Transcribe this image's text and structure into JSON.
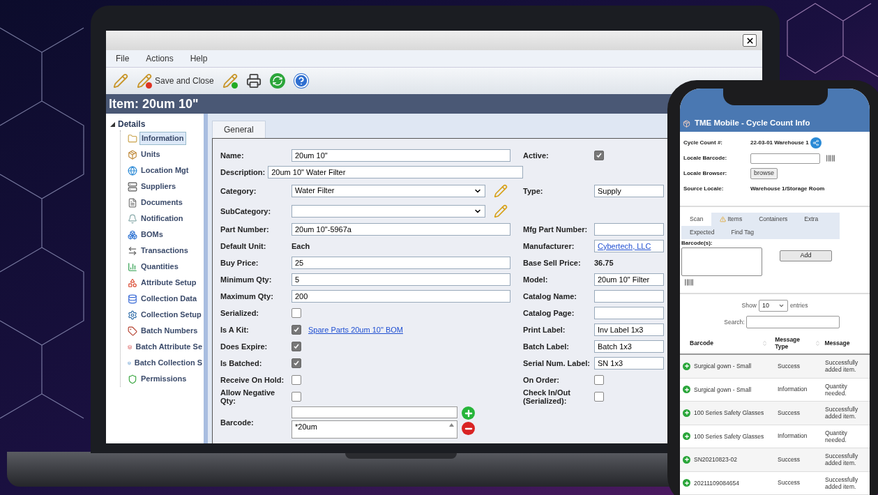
{
  "laptop": {
    "menu": [
      "File",
      "Actions",
      "Help"
    ],
    "toolbar": {
      "save_label": "Save and Close"
    },
    "header": "Item: 20um 10\"",
    "tree": {
      "label": "Details",
      "expanded": true,
      "children": [
        {
          "label": "Information",
          "selected": true
        },
        {
          "label": "Units",
          "selected": false
        },
        {
          "label": "Location Mgt",
          "selected": false
        },
        {
          "label": "Suppliers",
          "selected": false
        },
        {
          "label": "Documents",
          "selected": false
        },
        {
          "label": "Notification",
          "selected": false
        },
        {
          "label": "BOMs",
          "selected": false
        },
        {
          "label": "Transactions",
          "selected": false
        },
        {
          "label": "Quantities",
          "selected": false
        },
        {
          "label": "Attribute Setup",
          "selected": false
        },
        {
          "label": "Collection Data",
          "selected": false
        },
        {
          "label": "Collection Setup",
          "selected": false
        },
        {
          "label": "Batch Numbers",
          "selected": false
        },
        {
          "label": "Batch Attribute Se",
          "selected": false
        },
        {
          "label": "Batch Collection S",
          "selected": false
        },
        {
          "label": "Permissions",
          "selected": false
        }
      ]
    },
    "tabs": [
      {
        "label": "General",
        "selected": true
      }
    ],
    "rows": [
      {
        "left": {
          "label": "Name:",
          "kind": "input",
          "value": "20um 10\""
        },
        "right": {
          "label": "Active:",
          "kind": "checkbox",
          "checked": true
        }
      },
      {
        "left": {
          "label": "Description:",
          "kind": "wide",
          "value": "20um 10\" Water Filter"
        }
      },
      {
        "left": {
          "label": "Category:",
          "kind": "select",
          "value": "Water Filter"
        },
        "right": {
          "label": "Type:",
          "kind": "input",
          "value": "Supply"
        }
      },
      {
        "left": {
          "label": "SubCategory:",
          "kind": "select"
        }
      },
      {
        "left": {
          "label": "Part Number:",
          "kind": "input",
          "value": "20um 10\"-5967a"
        },
        "right": {
          "label": "Mfg Part Number:",
          "kind": "input"
        }
      },
      {
        "left": {
          "label": "Default Unit:",
          "kind": "static",
          "value": "Each"
        },
        "right": {
          "label": "Manufacturer:",
          "kind": "linkbox",
          "value": "Cybertech, LLC"
        }
      },
      {
        "left": {
          "label": "Buy Price:",
          "kind": "input",
          "value": "25"
        },
        "right": {
          "label": "Base Sell Price:",
          "kind": "static",
          "value": "36.75"
        }
      },
      {
        "left": {
          "label": "Minimum Qty:",
          "kind": "input",
          "value": "5"
        },
        "right": {
          "label": "Model:",
          "kind": "input",
          "value": "20um 10\" Filter"
        }
      },
      {
        "left": {
          "label": "Maximum Qty:",
          "kind": "input",
          "value": "200"
        },
        "right": {
          "label": "Catalog Name:",
          "kind": "input"
        }
      },
      {
        "left": {
          "label": "Serialized:",
          "kind": "checkbox",
          "checked": false
        },
        "right": {
          "label": "Catalog Page:",
          "kind": "input"
        }
      },
      {
        "left": {
          "label": "Is A Kit:",
          "kind": "checkbox",
          "checked": true,
          "link": "Spare Parts 20um 10\" BOM"
        },
        "right": {
          "label": "Print Label:",
          "kind": "input",
          "value": "Inv Label 1x3"
        }
      },
      {
        "left": {
          "label": "Does Expire:",
          "kind": "checkbox",
          "checked": true
        },
        "right": {
          "label": "Batch Label:",
          "kind": "input",
          "value": "Batch 1x3"
        }
      },
      {
        "left": {
          "label": "Is Batched:",
          "kind": "checkbox",
          "checked": true
        },
        "right": {
          "label": "Serial Num. Label:",
          "kind": "input",
          "value": "SN 1x3"
        }
      },
      {
        "left": {
          "label": "Receive On Hold:",
          "kind": "checkbox",
          "checked": false
        },
        "right": {
          "label": "On Order:",
          "kind": "checkbox",
          "checked": false
        }
      },
      {
        "left": {
          "label": "Allow Negative Qty:",
          "kind": "checkbox",
          "checked": false
        },
        "right": {
          "label": "Check In/Out (Serialized):",
          "kind": "checkbox",
          "checked": false
        }
      },
      {
        "left": {
          "label": "Barcode:",
          "kind": "barcode",
          "list": "*20um"
        }
      }
    ]
  },
  "phone": {
    "title": "TME Mobile - Cycle Count Info",
    "info": [
      {
        "label": "Cycle Count #:",
        "kind": "static",
        "value": "22-03-01 Warehouse 1"
      },
      {
        "label": "Locale Barcode:",
        "kind": "input"
      },
      {
        "label": "Locale Browser:",
        "kind": "button",
        "value": "browse"
      },
      {
        "label": "Source Locale:",
        "kind": "static",
        "value": "Warehouse 1/Storage Room"
      }
    ],
    "tabs": [
      {
        "label": "Scan",
        "selected": true
      },
      {
        "label": "Items",
        "selected": false
      },
      {
        "label": "Containers",
        "selected": false
      },
      {
        "label": "Extra",
        "selected": false
      },
      {
        "label": "Expected",
        "selected": false
      },
      {
        "label": "Find Tag",
        "selected": false
      }
    ],
    "barcodes_label": "Barcode(s):",
    "add_button": "Add",
    "show": {
      "before": "Show",
      "value": "10",
      "after": "entries"
    },
    "search_label": "Search:",
    "columns": [
      "Barcode",
      "Message Type",
      "Message"
    ],
    "rows": [
      {
        "barcode": "Surgical gown - Small",
        "type": "Success",
        "message": "Successfully added item."
      },
      {
        "barcode": "Surgical gown - Small",
        "type": "Information",
        "message": "Quantity needed."
      },
      {
        "barcode": "100 Series Safety Glasses",
        "type": "Success",
        "message": "Successfully added item."
      },
      {
        "barcode": "100 Series Safety Glasses",
        "type": "Information",
        "message": "Quantity needed."
      },
      {
        "barcode": "SN20210823-02",
        "type": "Success",
        "message": "Successfully added item."
      },
      {
        "barcode": "20211109084654",
        "type": "Success",
        "message": "Successfully added item."
      }
    ]
  }
}
